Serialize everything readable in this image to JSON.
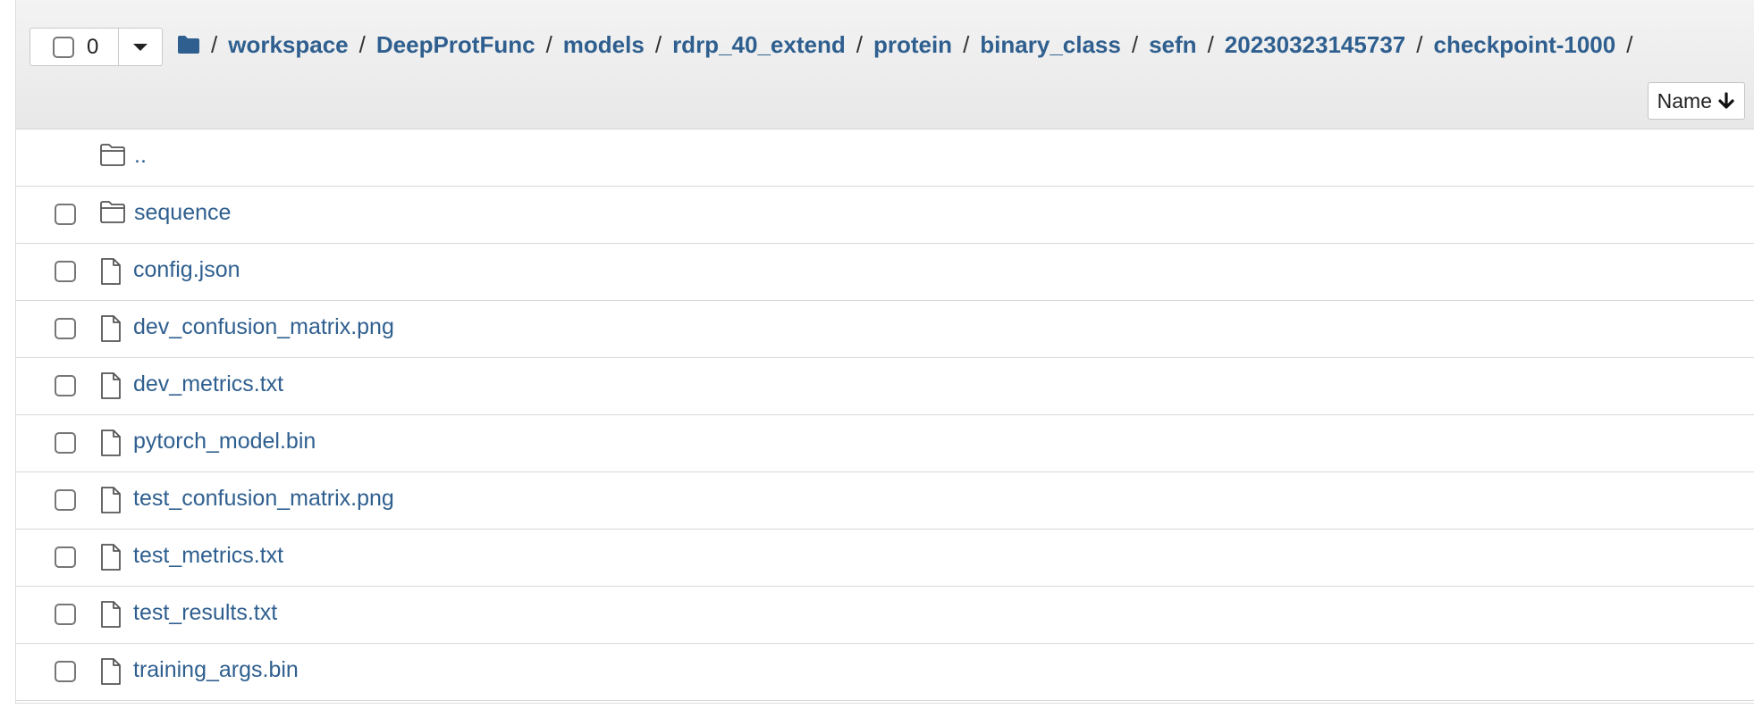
{
  "selection": {
    "count": "0"
  },
  "breadcrumb": {
    "root_separator": "/",
    "items": [
      "workspace",
      "DeepProtFunc",
      "models",
      "rdrp_40_extend",
      "protein",
      "binary_class",
      "sefn",
      "20230323145737",
      "checkpoint-1000"
    ],
    "separator": "/"
  },
  "sort": {
    "label": "Name",
    "direction_icon": "arrow-down-icon"
  },
  "listing": {
    "parent": {
      "name": "..",
      "icon": "folder-icon"
    },
    "items": [
      {
        "name": "sequence",
        "icon": "folder-icon"
      },
      {
        "name": "config.json",
        "icon": "file-icon"
      },
      {
        "name": "dev_confusion_matrix.png",
        "icon": "file-icon"
      },
      {
        "name": "dev_metrics.txt",
        "icon": "file-icon"
      },
      {
        "name": "pytorch_model.bin",
        "icon": "file-icon"
      },
      {
        "name": "test_confusion_matrix.png",
        "icon": "file-icon"
      },
      {
        "name": "test_metrics.txt",
        "icon": "file-icon"
      },
      {
        "name": "test_results.txt",
        "icon": "file-icon"
      },
      {
        "name": "training_args.bin",
        "icon": "file-icon"
      }
    ]
  },
  "colors": {
    "link": "#2f5f8f",
    "header_bg": "#ececec",
    "folder_solid": "#2f5f8f"
  }
}
